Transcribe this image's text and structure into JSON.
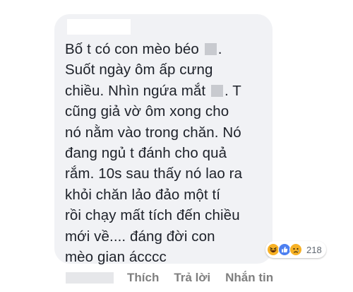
{
  "comment": {
    "lines": [
      {
        "before": "Bố t có con mèo béo ",
        "after": "."
      },
      {
        "before": "Suốt ngày ôm ấp cưng",
        "after": ""
      },
      {
        "before": "chiều. Nhìn ngứa mắt ",
        "after": ". T"
      },
      {
        "before": "cũng giả vờ ôm xong cho",
        "after": ""
      },
      {
        "before": "nó nằm vào trong chăn. Nó",
        "after": ""
      },
      {
        "before": "đang ngủ t đánh cho quả",
        "after": ""
      },
      {
        "before": "rắm. 10s sau thấy nó lao ra",
        "after": ""
      },
      {
        "before": "khỏi chăn lảo đảo một tí",
        "after": ""
      },
      {
        "before": "rồi chạy mất tích đến chiều",
        "after": ""
      },
      {
        "before": "mới về.... đáng đời con",
        "after": ""
      },
      {
        "before": "mèo gian ácccc",
        "after": ""
      }
    ]
  },
  "reactions": {
    "icons": [
      "haha-icon",
      "like-icon",
      "sad-icon"
    ],
    "count": "218"
  },
  "actions": {
    "like_label": "Thích",
    "reply_label": "Trả lời",
    "message_label": "Nhắn tin"
  },
  "colors": {
    "bubble": "#f1f2f5",
    "text": "#1d2129",
    "action": "#7f7f7f",
    "like_blue": "#4c7ff0",
    "emoji_yellow": "#f7b125"
  }
}
